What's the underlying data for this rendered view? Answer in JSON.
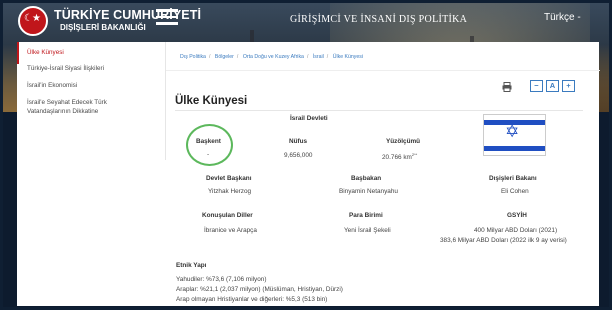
{
  "header": {
    "brand_line1": "TÜRKİYE CUMHURİYETİ",
    "brand_line2": "DIŞİŞLERİ BAKANLIĞI",
    "title": "GİRİŞİMCİ VE İNSANİ DIŞ POLİTİKA",
    "language": "Türkçe -"
  },
  "sidebar": {
    "items": [
      {
        "label": "Ülke Künyesi"
      },
      {
        "label": "Türkiye-İsrail Siyasi İlişkileri"
      },
      {
        "label": "İsrail'in Ekonomisi"
      },
      {
        "label": "İsrail'e Seyahat Edecek Türk Vatandaşlarının Dikkatine"
      }
    ]
  },
  "breadcrumb": [
    "Dış Politika",
    "Bölgeler",
    "Orta Doğu ve Kuzey Afrika",
    "İsrail",
    "Ülke Künyesi"
  ],
  "toolbar": {
    "zoom_out": "−",
    "zoom_reset": "A",
    "zoom_in": "+"
  },
  "page": {
    "title": "Ülke Künyesi",
    "country_name": "İsrail Devleti",
    "capital_label": "Başkent",
    "capital_value": "-",
    "population_label": "Nüfus",
    "population_value": "9,656,000",
    "area_label": "Yüzölçümü",
    "area_value": "20.766 km",
    "area_sup": "2**",
    "head_of_state_label": "Devlet Başkanı",
    "head_of_state_value": "Yitzhak Herzog",
    "pm_label": "Başbakan",
    "pm_value": "Binyamin Netanyahu",
    "fm_label": "Dışişleri Bakanı",
    "fm_value": "Eli Cohen",
    "languages_label": "Konuşulan Diller",
    "languages_value": "İbranice ve Arapça",
    "currency_label": "Para Birimi",
    "currency_value": "Yeni İsrail Şekeli",
    "gdp_label": "GSYİH",
    "gdp_value_1": "400 Milyar ABD Doları (2021)",
    "gdp_value_2": "383,6 Milyar ABD Doları (2022 ilk 9 ay verisi)",
    "ethnic_label": "Etnik Yapı",
    "ethnic_lines": [
      "Yahudiler: %73,6 (7,106 milyon)",
      "Araplar: %21,1 (2,037 milyon) (Müslüman, Hristiyan, Dürzi)",
      "Arap olmayan Hristiyanlar ve diğerleri: %5,3 (513 bin)"
    ]
  },
  "colors": {
    "accent_red": "#c0161b",
    "link_blue": "#3b7bbf",
    "highlight_green": "#5cb85c",
    "flag_blue": "#1f4ec2"
  }
}
